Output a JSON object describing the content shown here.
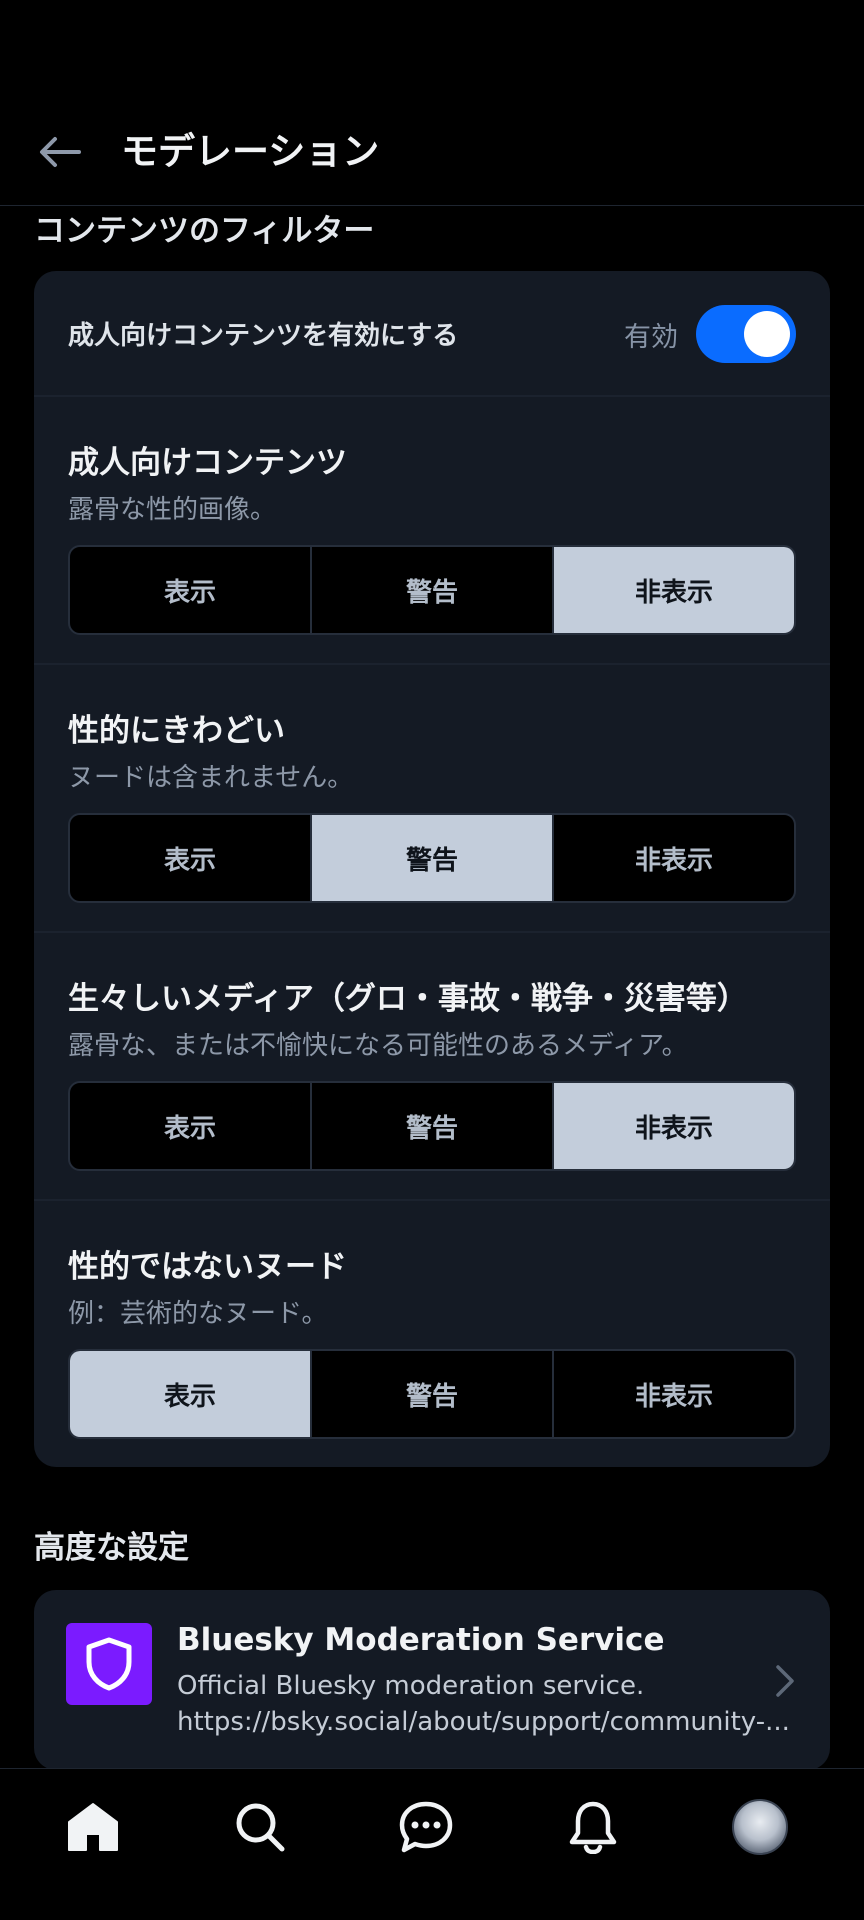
{
  "header": {
    "title": "モデレーション"
  },
  "content_filters": {
    "section_title": "コンテンツのフィルター",
    "adult_toggle": {
      "label": "成人向けコンテンツを有効にする",
      "state_label": "有効",
      "enabled": true
    },
    "preferences": [
      {
        "title": "成人向けコンテンツ",
        "description": "露骨な性的画像。",
        "options": [
          "表示",
          "警告",
          "非表示"
        ],
        "selected": "非表示"
      },
      {
        "title": "性的にきわどい",
        "description": "ヌードは含まれません。",
        "options": [
          "表示",
          "警告",
          "非表示"
        ],
        "selected": "警告"
      },
      {
        "title": "生々しいメディア（グロ・事故・戦争・災害等）",
        "description": "露骨な、または不愉快になる可能性のあるメディア。",
        "options": [
          "表示",
          "警告",
          "非表示"
        ],
        "selected": "非表示"
      },
      {
        "title": "性的ではないヌード",
        "description": "例：芸術的なヌード。",
        "options": [
          "表示",
          "警告",
          "非表示"
        ],
        "selected": "表示"
      }
    ]
  },
  "advanced": {
    "section_title": "高度な設定",
    "service": {
      "name": "Bluesky Moderation Service",
      "description": "Official Bluesky moderation service. https://bsky.social/about/support/community-...",
      "icon": "shield-icon",
      "icon_bg": "#7b1bff"
    }
  },
  "bottom_nav": {
    "items": [
      "home-icon",
      "search-icon",
      "chat-icon",
      "bell-icon",
      "avatar"
    ]
  },
  "colors": {
    "accent": "#0a6cff",
    "card_bg": "#141a24",
    "selected_bg": "#c3cddb"
  }
}
